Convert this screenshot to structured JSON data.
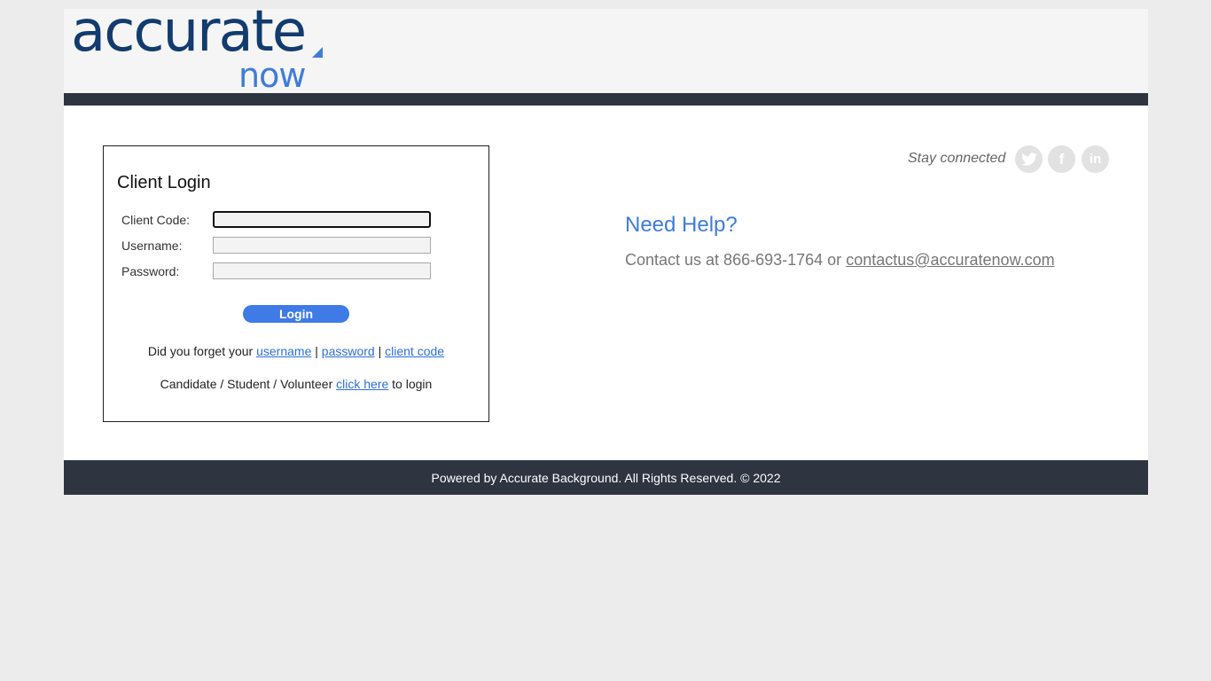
{
  "logo": {
    "main": "accurate",
    "sub": "now"
  },
  "login": {
    "title": "Client Login",
    "fields": [
      {
        "label": "Client Code:",
        "value": ""
      },
      {
        "label": "Username:",
        "value": ""
      },
      {
        "label": "Password:",
        "value": ""
      }
    ],
    "button": "Login",
    "forgot": {
      "prefix": "Did you forget your",
      "username": "username",
      "sep": "|",
      "password": "password",
      "client_code": "client code"
    },
    "candidate": {
      "prefix": "Candidate / Student / Volunteer",
      "link": "click here",
      "suffix": "to login"
    }
  },
  "social": {
    "label": "Stay connected",
    "icons": [
      "twitter-icon",
      "facebook-icon",
      "linkedin-icon"
    ]
  },
  "help": {
    "title": "Need Help?",
    "prefix": "Contact us at 866-693-1764 or",
    "email": "contactus@accuratenow.com"
  },
  "footer": {
    "text": "Powered by Accurate Background. All Rights Reserved. © 2022"
  },
  "colors": {
    "brand_navy": "#123b6e",
    "brand_blue": "#3f7cd8",
    "bar": "#2e3440"
  }
}
